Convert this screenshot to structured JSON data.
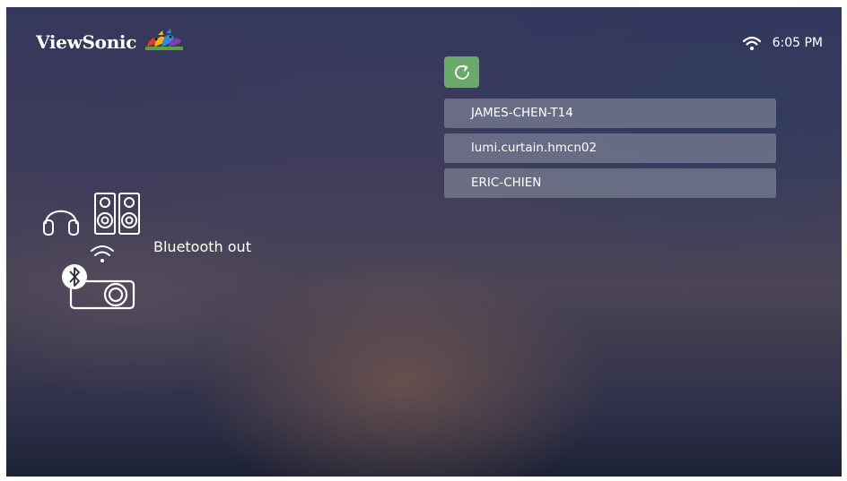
{
  "header": {
    "brand": "ViewSonic",
    "logo_icon": "viewsonic-birds-logo-icon",
    "wifi_icon": "wifi-icon",
    "time": "6:05 PM"
  },
  "bluetooth": {
    "label": "Bluetooth out",
    "icons": [
      "headphones-icon",
      "speakers-icon",
      "projector-icon",
      "bluetooth-icon",
      "wifi-icon"
    ]
  },
  "refresh": {
    "icon": "refresh-icon",
    "color": "#6aa86c"
  },
  "devices": [
    {
      "name": "JAMES-CHEN-T14"
    },
    {
      "name": "lumi.curtain.hmcn02"
    },
    {
      "name": "ERIC-CHIEN"
    }
  ],
  "colors": {
    "list_item_bg": "#868a9c",
    "text": "#ffffff"
  }
}
